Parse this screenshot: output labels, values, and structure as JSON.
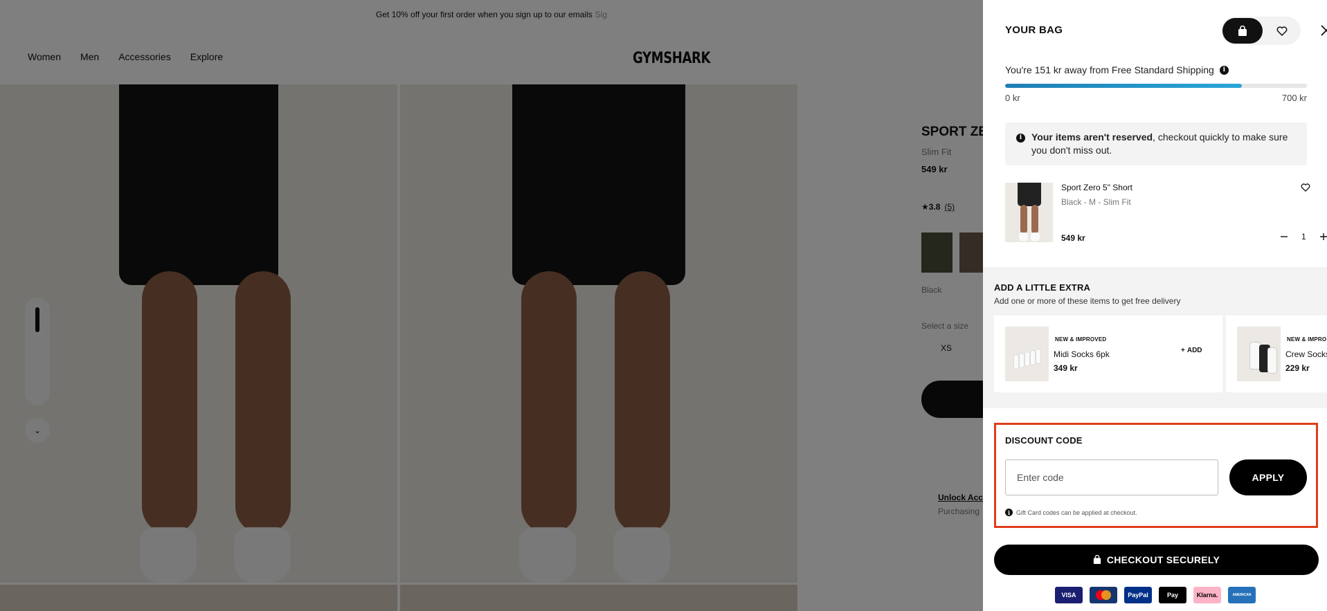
{
  "promo": {
    "text": "Get 10% off your first order when you sign up to our emails",
    "link": "Sig"
  },
  "nav": {
    "links": [
      "Women",
      "Men",
      "Accessories",
      "Explore"
    ],
    "logo": "GYMSHARK"
  },
  "product": {
    "title": "SPORT ZE",
    "fit": "Slim Fit",
    "price": "549 kr",
    "rating": "3.8",
    "reviews": "(5)",
    "color": "Black",
    "size_label": "Select a size",
    "first_size": "XS",
    "unlock": "Unlock Acce",
    "purchasing": "Purchasing"
  },
  "bag": {
    "title": "YOUR BAG",
    "shipping_text": "You're 151 kr away from Free Standard Shipping",
    "progress_fraction": 0.784,
    "progress_min": "0 kr",
    "progress_max": "700 kr",
    "notice_bold": "Your items aren't reserved",
    "notice_rest": ", checkout quickly to make sure you don't miss out.",
    "item": {
      "name": "Sport Zero 5\" Short",
      "variant": "Black - M - Slim Fit",
      "price": "549 kr",
      "quantity": "1"
    },
    "extra": {
      "title": "ADD A LITTLE EXTRA",
      "subtitle": "Add one or more of these items to get free delivery",
      "products": [
        {
          "badge": "NEW & IMPROVED",
          "name": "Midi Socks 6pk",
          "price": "349 kr",
          "add": "ADD"
        },
        {
          "badge": "NEW & IMPRO",
          "name": "Crew Socks",
          "price": "229 kr"
        }
      ]
    },
    "discount": {
      "title": "DISCOUNT CODE",
      "placeholder": "Enter code",
      "value": "",
      "apply": "APPLY",
      "note": "Gift Card codes can be applied at checkout."
    },
    "checkout": "CHECKOUT SECURELY",
    "payments": [
      {
        "name": "VISA",
        "bg": "#1a1f71",
        "fg": "#ffffff"
      },
      {
        "name": "",
        "bg": "#16366f",
        "fg": "#ffffff"
      },
      {
        "name": "PayPal",
        "bg": "#003087",
        "fg": "#ffffff"
      },
      {
        "name": "Pay",
        "bg": "#000000",
        "fg": "#ffffff"
      },
      {
        "name": "Klarna.",
        "bg": "#ffb3c7",
        "fg": "#000000"
      },
      {
        "name": "AMERICAN",
        "bg": "#2671b9",
        "fg": "#ffffff"
      }
    ]
  },
  "colors": {
    "accent_outline": "#e03c1c",
    "progress": "#2aa6d9",
    "primary": "#000000"
  }
}
